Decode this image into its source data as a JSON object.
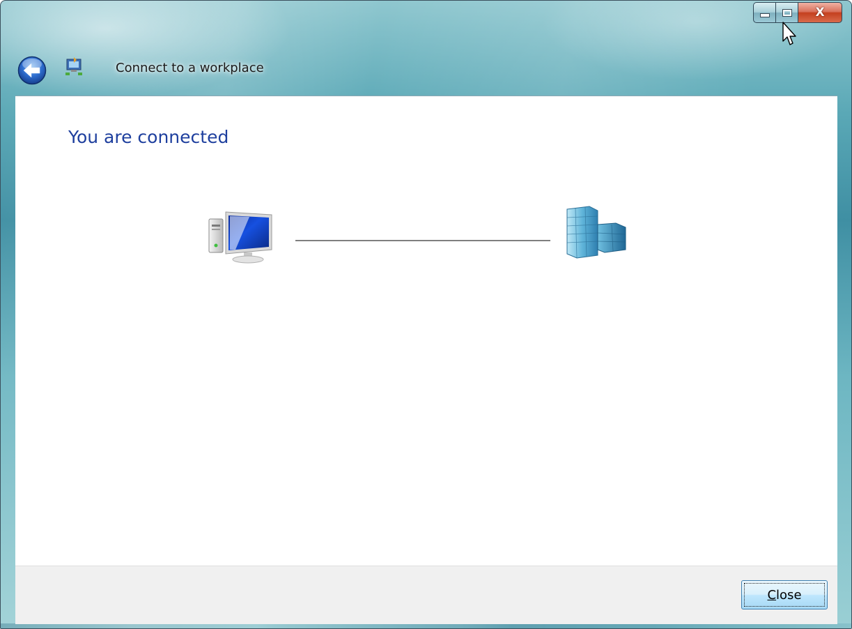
{
  "window": {
    "title": "Connect to a workplace",
    "caption": {
      "minimize_icon": "minimize-icon",
      "maximize_icon": "maximize-icon",
      "close_glyph": "X"
    }
  },
  "header": {
    "back_icon": "back-arrow-icon",
    "app_icon": "network-connection-icon"
  },
  "main": {
    "heading": "You are connected",
    "diagram": {
      "left_icon": "computer-icon",
      "right_icon": "workplace-building-icon",
      "status": "connected"
    }
  },
  "footer": {
    "close_button": {
      "accel": "C",
      "rest": "lose"
    }
  },
  "colors": {
    "heading": "#1e3f9e",
    "title_bar": "#5aa8b6",
    "footer_bg": "#f0f0f0",
    "close_caption": "#c4401f"
  }
}
